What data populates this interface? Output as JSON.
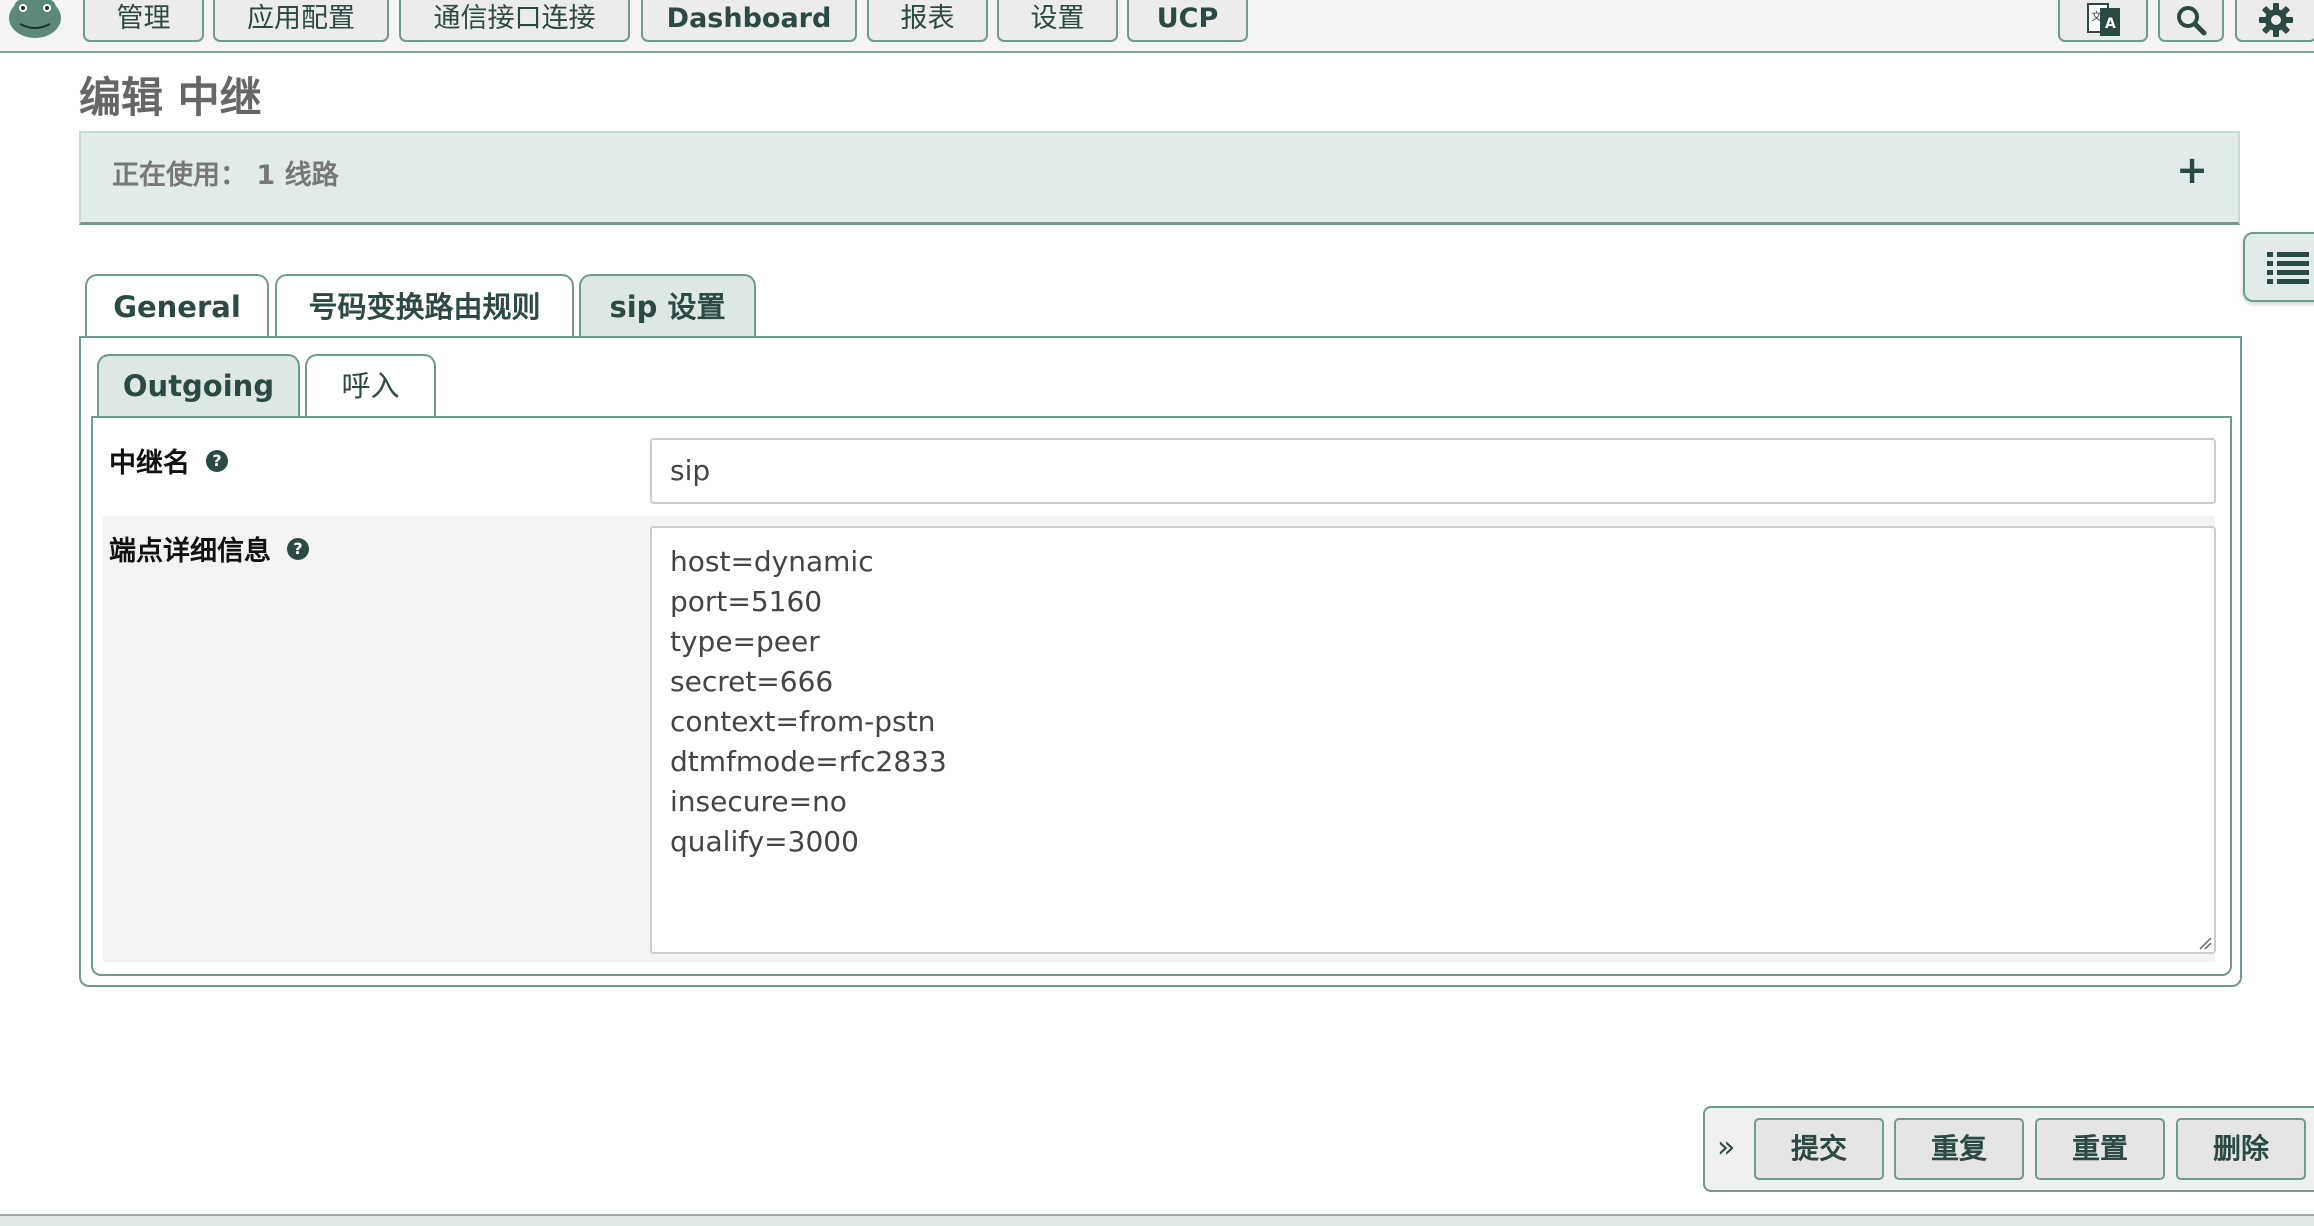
{
  "nav": {
    "items": [
      "管理",
      "应用配置",
      "通信接口连接",
      "Dashboard",
      "报表",
      "设置",
      "UCP"
    ],
    "icons": [
      "translate-icon",
      "search-icon",
      "gear-icon"
    ]
  },
  "page": {
    "title": "编辑 中继",
    "usage_text": "正在使用： 1 线路",
    "add_icon": "plus-icon"
  },
  "tabs": [
    "General",
    "号码变换路由规则",
    "sip 设置"
  ],
  "active_tab": "sip 设置",
  "subtabs": [
    "Outgoing",
    "呼入"
  ],
  "active_subtab": "Outgoing",
  "form": {
    "trunk_name_label": "中继名",
    "trunk_name_value": "sip",
    "peer_details_label": "端点详细信息",
    "peer_details_lines": [
      "host=dynamic",
      "port=5160",
      "type=peer",
      "secret=666",
      "context=from-pstn",
      "dtmfmode=rfc2833",
      "insecure=no",
      "qualify=3000"
    ]
  },
  "actions": {
    "collapse": "»",
    "submit": "提交",
    "duplicate": "重复",
    "reset": "重置",
    "delete": "删除"
  },
  "colors": {
    "accent": "#2c4a44",
    "border": "#6d9c8a",
    "panel_bg": "#e1ecea"
  }
}
